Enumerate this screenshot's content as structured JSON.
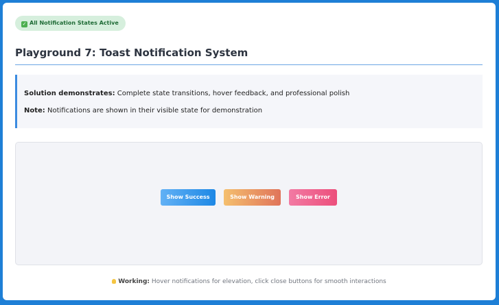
{
  "status_badge": {
    "icon": "check-icon",
    "label": "All Notification States Active",
    "color": "#1f6b36",
    "background": "#d6efdd"
  },
  "page": {
    "title": "Playground 7: Toast Notification System"
  },
  "info": {
    "line1_label": "Solution demonstrates:",
    "line1_text": " Complete state transitions, hover feedback, and professional polish",
    "line2_label": "Note:",
    "line2_text": " Notifications are shown in their visible state for demonstration"
  },
  "buttons": {
    "success": "Show Success",
    "warning": "Show Warning",
    "error": "Show Error"
  },
  "footer": {
    "icon": "lightbulb-icon",
    "label": "Working:",
    "text": " Hover notifications for elevation, click close buttons for smooth interactions"
  },
  "colors": {
    "frame_border": "#1e7fd6",
    "accent": "#3b8be0",
    "success": "#1e88e5",
    "warning": "#e0745a",
    "error": "#ec4f7c"
  }
}
